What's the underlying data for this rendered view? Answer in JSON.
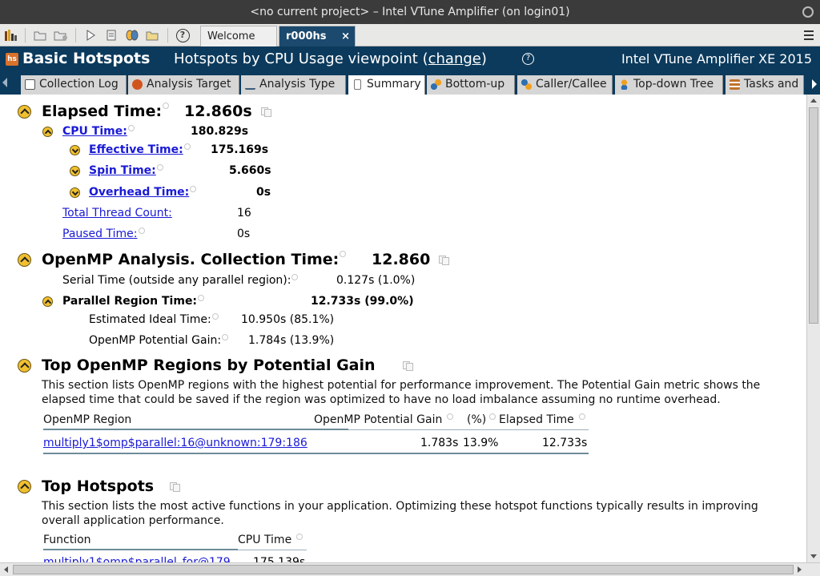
{
  "window": {
    "title": "<no current project> – Intel VTune Amplifier (on login01)"
  },
  "toolbar": {
    "icons": [
      "chart-icon",
      "new-project-icon",
      "project-properties-icon",
      "run-icon",
      "new-analysis-icon",
      "compare-icon",
      "open-icon",
      "help-icon"
    ],
    "help_glyph": "?"
  },
  "doc_tabs": [
    {
      "label": "Welcome",
      "active": false
    },
    {
      "label": "r000hs",
      "active": true,
      "close": "×"
    }
  ],
  "header": {
    "analysis_name": "Basic Hotspots",
    "viewpoint_prefix": "Hotspots by CPU Usage viewpoint (",
    "viewpoint_link": "change",
    "viewpoint_suffix": ")",
    "help_glyph": "?",
    "product": "Intel VTune Amplifier XE 2015"
  },
  "subtabs": [
    {
      "label": "Collection Log",
      "icon": "log-icon",
      "color": "#6e6e6e"
    },
    {
      "label": "Analysis Target",
      "icon": "target-icon",
      "color": "#d0551d"
    },
    {
      "label": "Analysis Type",
      "icon": "analysis-type-icon",
      "color": "#3a5b7a"
    },
    {
      "label": "Summary",
      "icon": "summary-icon",
      "color": "#7a7a7a",
      "active": true
    },
    {
      "label": "Bottom-up",
      "icon": "bottom-up-icon",
      "color": "#2d6fb0"
    },
    {
      "label": "Caller/Callee",
      "icon": "caller-callee-icon",
      "color": "#2d6fb0"
    },
    {
      "label": "Top-down Tree",
      "icon": "top-down-icon",
      "color": "#2d6fb0"
    },
    {
      "label": "Tasks and",
      "icon": "tasks-icon",
      "color": "#c0722b"
    }
  ],
  "summary": {
    "elapsed": {
      "label": "Elapsed Time:",
      "value": "12.860s"
    },
    "cpu_time": {
      "label": "CPU Time:",
      "value": "180.829s"
    },
    "effective_time": {
      "label": "Effective Time:",
      "value": "175.169s"
    },
    "spin_time": {
      "label": "Spin Time:",
      "value": "5.660s"
    },
    "overhead_time": {
      "label": "Overhead Time:",
      "value": "0s"
    },
    "thread_count": {
      "label": "Total Thread Count:",
      "value": "16"
    },
    "paused_time": {
      "label": "Paused Time:",
      "value": "0s"
    }
  },
  "openmp": {
    "title": "OpenMP Analysis. Collection Time:",
    "value": "12.860",
    "serial": {
      "label": "Serial Time (outside any parallel region):",
      "value": "0.127s (1.0%)"
    },
    "parallel": {
      "label": "Parallel Region Time:",
      "value": "12.733s (99.0%)"
    },
    "ideal": {
      "label": "Estimated Ideal Time:",
      "value": "10.950s (85.1%)"
    },
    "gain": {
      "label": "OpenMP Potential Gain:",
      "value": "1.784s (13.9%)"
    }
  },
  "top_regions": {
    "title": "Top OpenMP Regions by Potential Gain",
    "description": "This section lists OpenMP regions with the highest potential for performance improvement. The Potential Gain metric shows the elapsed time that could be saved if the region was optimized to have no load imbalance assuming no runtime overhead.",
    "columns": [
      "OpenMP Region",
      "OpenMP Potential Gain",
      "(%)",
      "Elapsed Time"
    ],
    "rows": [
      {
        "region": "multiply1$omp$parallel:16@unknown:179:186",
        "gain": "1.783s",
        "pct": "13.9%",
        "elapsed": "12.733s"
      }
    ]
  },
  "top_hotspots": {
    "title": "Top Hotspots",
    "description": "This section lists the most active functions in your application. Optimizing these hotspot functions typically results in improving overall application performance.",
    "columns": [
      "Function",
      "CPU Time"
    ],
    "rows": [
      {
        "function": "multiply1$omp$parallel_for@179",
        "cpu_time": "175.139s"
      }
    ]
  }
}
